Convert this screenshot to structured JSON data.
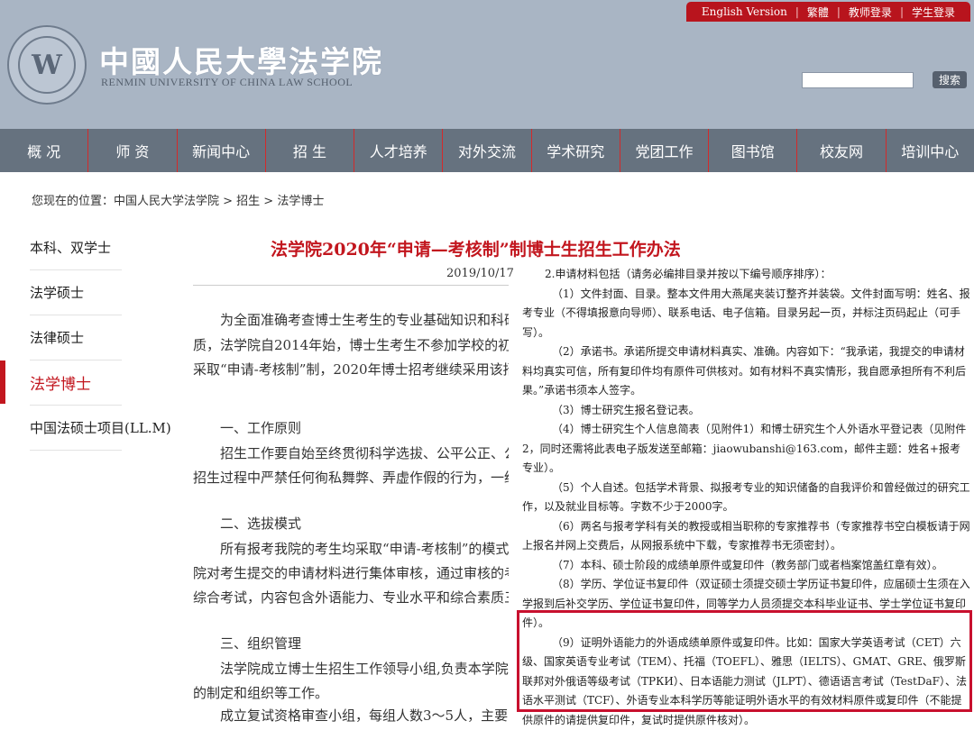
{
  "toplinks": {
    "english": "English Version",
    "traditional": "繁體",
    "teacher": "教师登录",
    "student": "学生登录"
  },
  "logo": {
    "seal_letter": "W",
    "cn": "中國人民大學法学院",
    "en": "RENMIN UNIVERSITY OF CHINA LAW SCHOOL"
  },
  "search": {
    "button": "搜索",
    "placeholder": ""
  },
  "nav": [
    "概 况",
    "师 资",
    "新闻中心",
    "招 生",
    "人才培养",
    "对外交流",
    "学术研究",
    "党团工作",
    "图书馆",
    "校友网",
    "培训中心"
  ],
  "breadcrumb": "您现在的位置：中国人民大学法学院 > 招生 > 法学博士",
  "sidebar": [
    {
      "label": "本科、双学士",
      "active": false
    },
    {
      "label": "法学硕士",
      "active": false
    },
    {
      "label": "法律硕士",
      "active": false
    },
    {
      "label": "法学博士",
      "active": true
    },
    {
      "label": "中国法硕士项目(LL.M)",
      "active": false
    }
  ],
  "article": {
    "title": "法学院2020年“申请—考核制”制博士生招生工作办法",
    "date": "2019/10/17",
    "paragraphs": [
      "为全面准确考查博士生考生的专业基础知识和科研",
      "质，法学院自2014年始，博士生考生不参加学校的初试",
      "采取“申请-考核制”制，2020年博士招考继续采用该招",
      "一、工作原则",
      "招生工作要自始至终贯彻科学选拔、公平公正、公",
      "招生过程中严禁任何徇私舞弊、弄虚作假的行为，一经",
      "二、选拔模式",
      "所有报考我院的考生均采取“申请-考核制”的模式",
      "院对考生提交的申请材料进行集体审核，通过审核的考",
      "综合考试，内容包含外语能力、专业水平和综合素质三",
      "三、组织管理",
      "法学院成立博士生招生工作领导小组,负责本学院",
      "的制定和组织等工作。",
      "成立复试资格审查小组，每组人数3～5人，主要"
    ]
  },
  "panel": {
    "heading": "2.申请材料包括（请务必编排目录并按以下编号顺序排序）：",
    "items": [
      "（1）文件封面、目录。整本文件用大燕尾夹装订整齐并装袋。文件封面写明：姓名、报考专业（不得填报意向导师）、联系电话、电子信箱。目录另起一页，并标注页码起止（可手写）。",
      "（2）承诺书。承诺所提交申请材料真实、准确。内容如下：“我承诺，我提交的申请材料均真实可信，所有复印件均有原件可供核对。如有材料不真实情形，我自愿承担所有不利后果。”承诺书须本人签字。",
      "（3）博士研究生报名登记表。",
      "（4）博士研究生个人信息简表（见附件1）和博士研究生个人外语水平登记表（见附件2，同时还需将此表电子版发送至邮箱：jiaowubanshi@163.com，邮件主题：姓名+报考专业）。",
      "（5）个人自述。包括学术背景、拟报考专业的知识储备的自我评价和曾经做过的研究工作，以及就业目标等。字数不少于2000字。",
      "（6）两名与报考学科有关的教授或相当职称的专家推荐书（专家推荐书空白模板请于网上报名并网上交费后，从网报系统中下载，专家推荐书无须密封）。",
      "（7）本科、硕士阶段的成绩单原件或复印件（教务部门或者档案馆盖红章有效）。",
      "（8）学历、学位证书复印件（双证硕士须提交硕士学历证书复印件，应届硕士生须在入学报到后补交学历、学位证书复印件，同等学力人员须提交本科毕业证书、学士学位证书复印件）。",
      "（9）证明外语能力的外语成绩单原件或复印件。比如：国家大学英语考试（CET）六级、国家英语专业考试（TEM）、托福（TOEFL）、雅思（IELTS）、GMAT、GRE、俄罗斯联邦对外俄语等级考试（ТРКИ）、日本语能力测试（JLPT）、德语语言考试（TestDaF）、法语水平测试（TCF）、外语专业本科学历等能证明外语水平的有效材料原件或复印件（不能提供原件的请提供复印件，复试时提供原件核对）。"
    ]
  }
}
